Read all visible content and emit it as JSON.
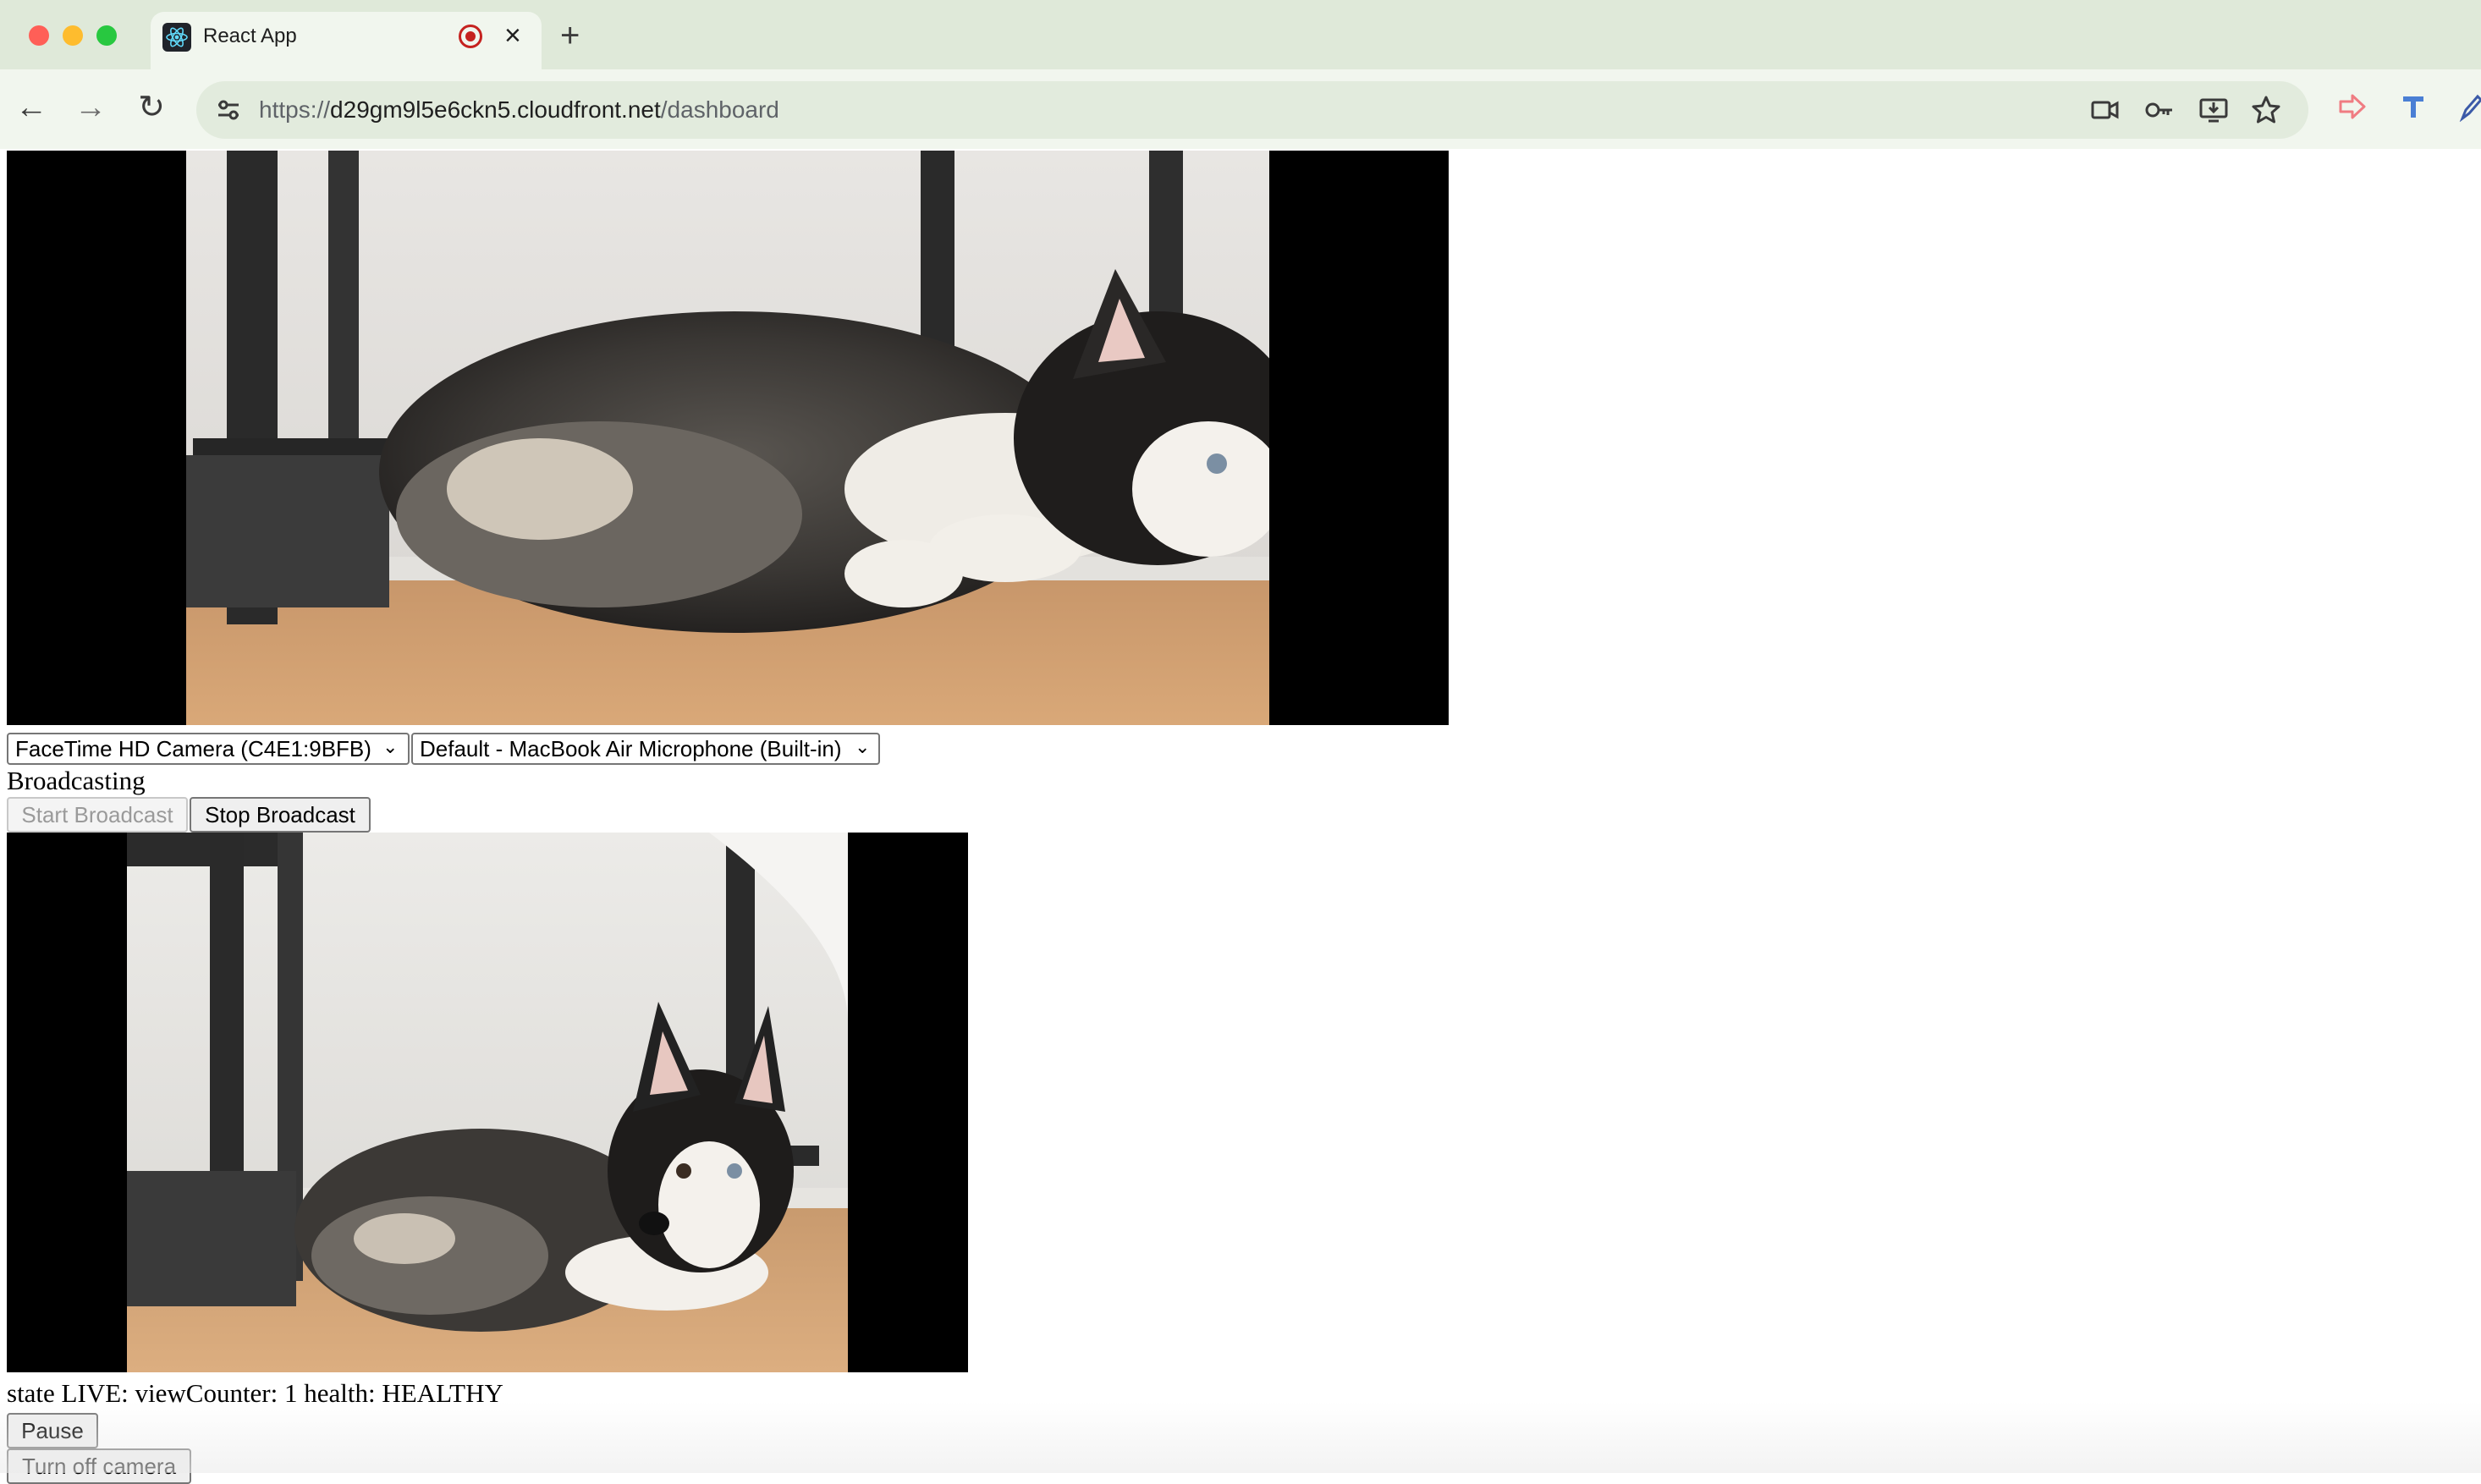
{
  "browser": {
    "tab_title": "React App",
    "tab_close": "×",
    "new_tab": "+",
    "url_protocol": "https://",
    "url_host": "d29gm9l5e6ckn5.cloudfront.net",
    "url_path": "/dashboard",
    "nav": {
      "back": "←",
      "forward": "→",
      "reload": "↻"
    }
  },
  "broadcast": {
    "camera_options": [
      "FaceTime HD Camera (C4E1:9BFB)"
    ],
    "camera_selected": "FaceTime HD Camera (C4E1:9BFB)",
    "microphone_options": [
      "Default - MacBook Air Microphone (Built-in)"
    ],
    "microphone_selected": "Default - MacBook Air Microphone (Built-in)",
    "status": "Broadcasting",
    "start_label": "Start Broadcast",
    "stop_label": "Stop Broadcast"
  },
  "player": {
    "status_line": "state LIVE: viewCounter: 1 health: HEALTHY",
    "pause_label": "Pause",
    "camera_toggle_label": "Turn off camera"
  }
}
